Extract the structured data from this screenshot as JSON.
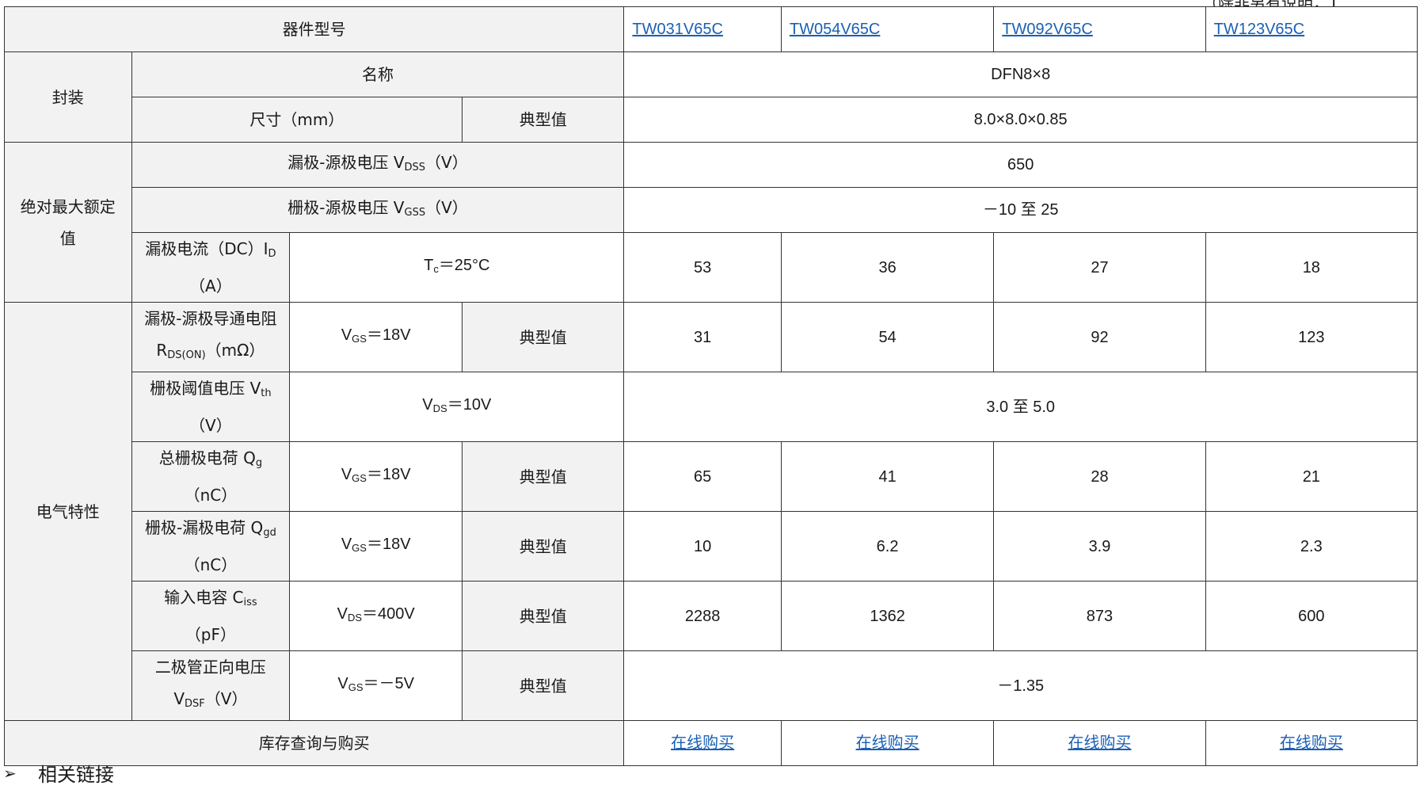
{
  "top_note": "（除非另有说明，T",
  "header": {
    "label": "器件型号",
    "models": [
      "TW031V65C",
      "TW054V65C",
      "TW092V65C",
      "TW123V65C"
    ]
  },
  "package": {
    "group": "封装",
    "name_label": "名称",
    "name_value": "DFN8×8",
    "size_label": "尺寸（mm）",
    "typ": "典型值",
    "size_value": "8.0×8.0×0.85"
  },
  "abs_max": {
    "group_line1": "绝对最大额定",
    "group_line2": "值",
    "vdss": {
      "pre": "漏极-源极电压 V",
      "sub": "DSS",
      "post": "（V）",
      "value": "650"
    },
    "vgss": {
      "pre": "栅极-源极电压 V",
      "sub": "GSS",
      "post": "（V）",
      "value": "－10 至 25"
    },
    "id": {
      "line1_pre": "漏极电流（DC）I",
      "line1_sub": "D",
      "line2": "（A）",
      "cond_pre": "T",
      "cond_sub": "c",
      "cond_post": "＝25°C",
      "values": [
        "53",
        "36",
        "27",
        "18"
      ]
    }
  },
  "electrical": {
    "group": "电气特性",
    "typ": "典型值",
    "rds": {
      "line1": "漏极-源极导通电阻",
      "line2_pre": "R",
      "line2_sub": "DS(ON)",
      "line2_post": "（mΩ）",
      "cond_pre": "V",
      "cond_sub": "GS",
      "cond_post": "＝18V",
      "values": [
        "31",
        "54",
        "92",
        "123"
      ]
    },
    "vth": {
      "line1_pre": "栅极阈值电压 V",
      "line1_sub": "th",
      "line2": "（V）",
      "cond_pre": "V",
      "cond_sub": "DS",
      "cond_post": "＝10V",
      "value": "3.0 至 5.0"
    },
    "qg": {
      "line1_pre": "总栅极电荷 Q",
      "line1_sub": "g",
      "line2": "（nC）",
      "cond_pre": "V",
      "cond_sub": "GS",
      "cond_post": "＝18V",
      "values": [
        "65",
        "41",
        "28",
        "21"
      ]
    },
    "qgd": {
      "line1_pre": "栅极-漏极电荷 Q",
      "line1_sub": "gd",
      "line2": "（nC）",
      "cond_pre": "V",
      "cond_sub": "GS",
      "cond_post": "＝18V",
      "values": [
        "10",
        "6.2",
        "3.9",
        "2.3"
      ]
    },
    "ciss": {
      "line1_pre": "输入电容 C",
      "line1_sub": "iss",
      "line2": "（pF）",
      "cond_pre": "V",
      "cond_sub": "DS",
      "cond_post": "＝400V",
      "values": [
        "2288",
        "1362",
        "873",
        "600"
      ]
    },
    "vdsf": {
      "line1": "二极管正向电压",
      "line2_pre": "V",
      "line2_sub": "DSF",
      "line2_post": "（V）",
      "cond_pre": "V",
      "cond_sub": "GS",
      "cond_post": "＝－5V",
      "value": "－1.35"
    }
  },
  "purchase": {
    "label": "库存查询与购买",
    "link": "在线购买"
  },
  "related": {
    "bullet": "➢",
    "label": "相关链接"
  }
}
